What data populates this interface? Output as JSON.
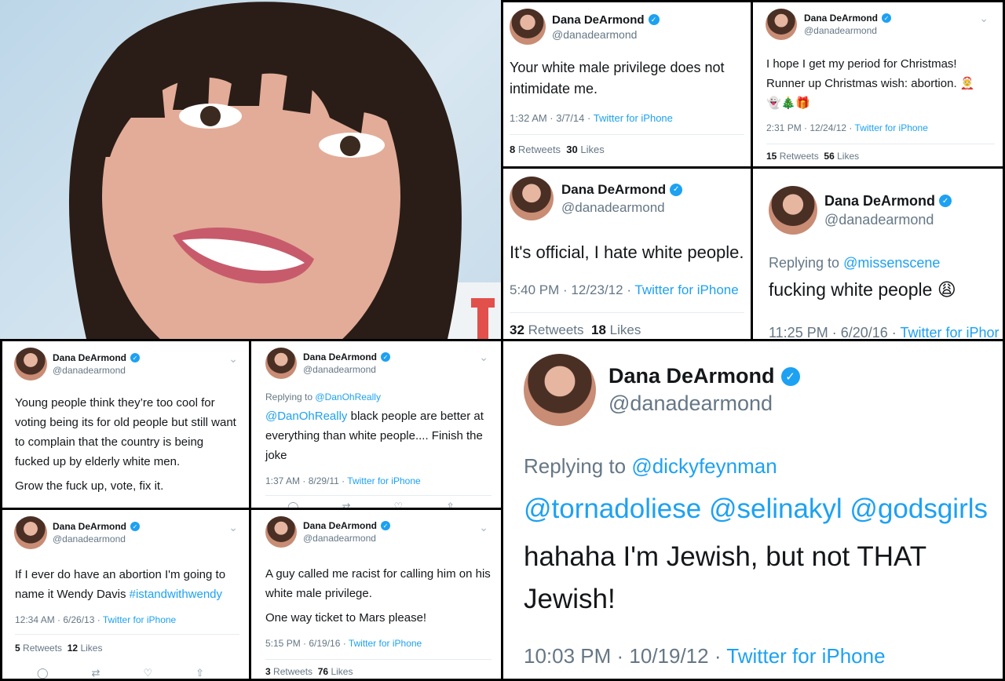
{
  "photo": {
    "alt": ""
  },
  "verified_mark": "✓",
  "icons": {
    "chevron": "⌄",
    "reply": "◯",
    "retweet": "⇄",
    "like": "♡",
    "share": "⇧",
    "emoji_weary": "😩",
    "emoji_santa": "🤶",
    "emoji_ghost": "👻",
    "emoji_tree": "🎄",
    "emoji_gift": "🎁"
  },
  "tweets": {
    "t1": {
      "name": "Dana DeArmond",
      "handle": "@danadearmond",
      "text": "Your white male privilege does not intimidate me.",
      "time": "1:32 AM · 3/7/14",
      "source": "Twitter for iPhone",
      "retweets": "8",
      "retweets_label": "Retweets",
      "likes": "30",
      "likes_label": "Likes"
    },
    "t2": {
      "name": "Dana DeArmond",
      "handle": "@danadearmond",
      "text": "I hope I get my period for Christmas! Runner up Christmas wish: abortion.",
      "time": "2:31 PM · 12/24/12",
      "source": "Twitter for iPhone",
      "retweets": "15",
      "retweets_label": "Retweets",
      "likes": "56",
      "likes_label": "Likes"
    },
    "t3": {
      "name": "Dana DeArmond",
      "handle": "@danadearmond",
      "text": "It's official, I hate white people.",
      "time": "5:40 PM · 12/23/12",
      "source": "Twitter for iPhone",
      "retweets": "32",
      "retweets_label": "Retweets",
      "likes": "18",
      "likes_label": "Likes"
    },
    "t4": {
      "name": "Dana DeArmond",
      "handle": "@danadearmond",
      "replying_label": "Replying to",
      "replying_to": "@missenscene",
      "text": "fucking white people",
      "time": "11:25 PM · 6/20/16",
      "source": "Twitter for iPhor"
    },
    "t5": {
      "name": "Dana DeArmond",
      "handle": "@danadearmond",
      "text": "Young people think they’re too cool for voting being its for old people but still want to complain that the country is being fucked up by elderly white men.",
      "text2": "Grow the fuck up, vote, fix it."
    },
    "t6": {
      "name": "Dana DeArmond",
      "handle": "@danadearmond",
      "replying_label": "Replying to",
      "replying_to": "@DanOhReally",
      "mention": "@DanOhReally",
      "text": "black people are better at everything than white people.... Finish the joke",
      "time": "1:37 AM · 8/29/11",
      "source": "Twitter for iPhone"
    },
    "t7": {
      "name": "Dana DeArmond",
      "handle": "@danadearmond",
      "replying_label": "Replying to",
      "replying_to": "@dickyfeynman",
      "mentions": "@tornadoliese @selinakyl @godsgirls",
      "text": "hahaha I'm Jewish, but  not THAT Jewish!",
      "time": "10:03 PM · 10/19/12",
      "source": "Twitter for iPhone"
    },
    "t8": {
      "name": "Dana DeArmond",
      "handle": "@danadearmond",
      "text": "If I ever do have an abortion I'm going to name it Wendy Davis",
      "hashtag": "#istandwithwendy",
      "time": "12:34 AM · 6/26/13",
      "source": "Twitter for iPhone",
      "retweets": "5",
      "retweets_label": "Retweets",
      "likes": "12",
      "likes_label": "Likes"
    },
    "t9": {
      "name": "Dana DeArmond",
      "handle": "@danadearmond",
      "text": "A guy called me racist for calling him on his white male privilege.",
      "text2": "One way ticket to Mars please!",
      "time": "5:15 PM · 6/19/16",
      "source": "Twitter for iPhone",
      "retweets": "3",
      "retweets_label": "Retweets",
      "likes": "76",
      "likes_label": "Likes"
    }
  }
}
